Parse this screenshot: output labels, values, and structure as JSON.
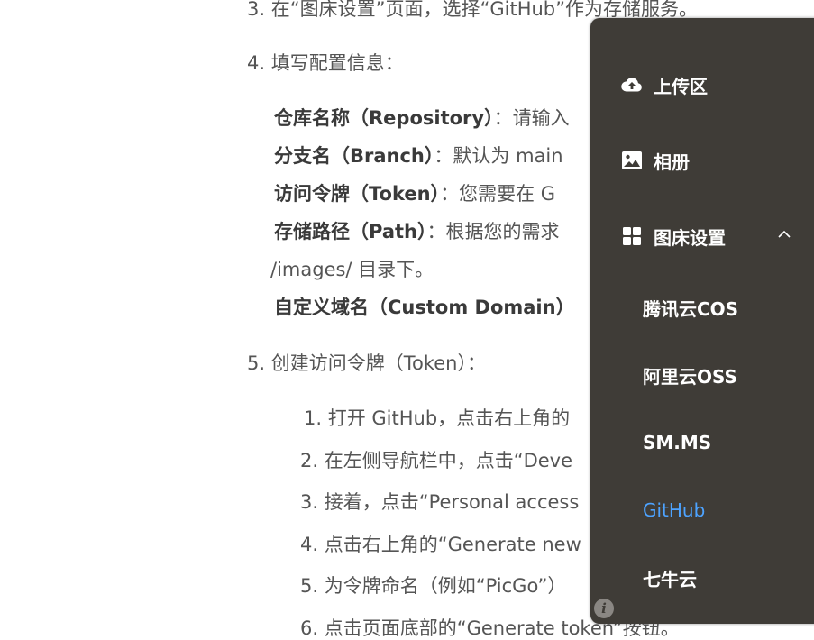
{
  "doc": {
    "step3": "3. 在“图床设置”页面，选择“GitHub”作为存储服务。",
    "step4": "4. 填写配置信息：",
    "fields": [
      {
        "name": "仓库名称（Repository）",
        "desc": "：请输入"
      },
      {
        "name": "分支名（Branch）",
        "desc": "：默认为 main"
      },
      {
        "name": "访问令牌（Token）",
        "desc": "：您需要在 G"
      },
      {
        "name": "存储路径（Path）",
        "desc": "：根据您的需求"
      }
    ],
    "path_cont": "/images/ 目录下。",
    "custom_domain": "自定义域名（Custom Domain）",
    "step5": "5. 创建访问令牌（Token）：",
    "substeps": [
      "1. 打开 GitHub，点击右上角的",
      "2. 在左侧导航栏中，点击“Deve",
      "3. 接着，点击“Personal access",
      "4. 点击右上角的“Generate new",
      "5. 为令牌命名（例如“PicGo”）",
      "6. 点击页面底部的“Generate token”按钮。"
    ]
  },
  "menu": {
    "items": [
      {
        "label": "上传区",
        "icon": "cloud-upload-icon"
      },
      {
        "label": "相册",
        "icon": "image-icon"
      },
      {
        "label": "图床设置",
        "icon": "grid-icon"
      }
    ],
    "subitems": [
      "腾讯云COS",
      "阿里云OSS",
      "SM.MS",
      "GitHub",
      "七牛云"
    ],
    "active_subitem": "GitHub",
    "active_color": "#4da3ff",
    "info_icon": "i"
  }
}
